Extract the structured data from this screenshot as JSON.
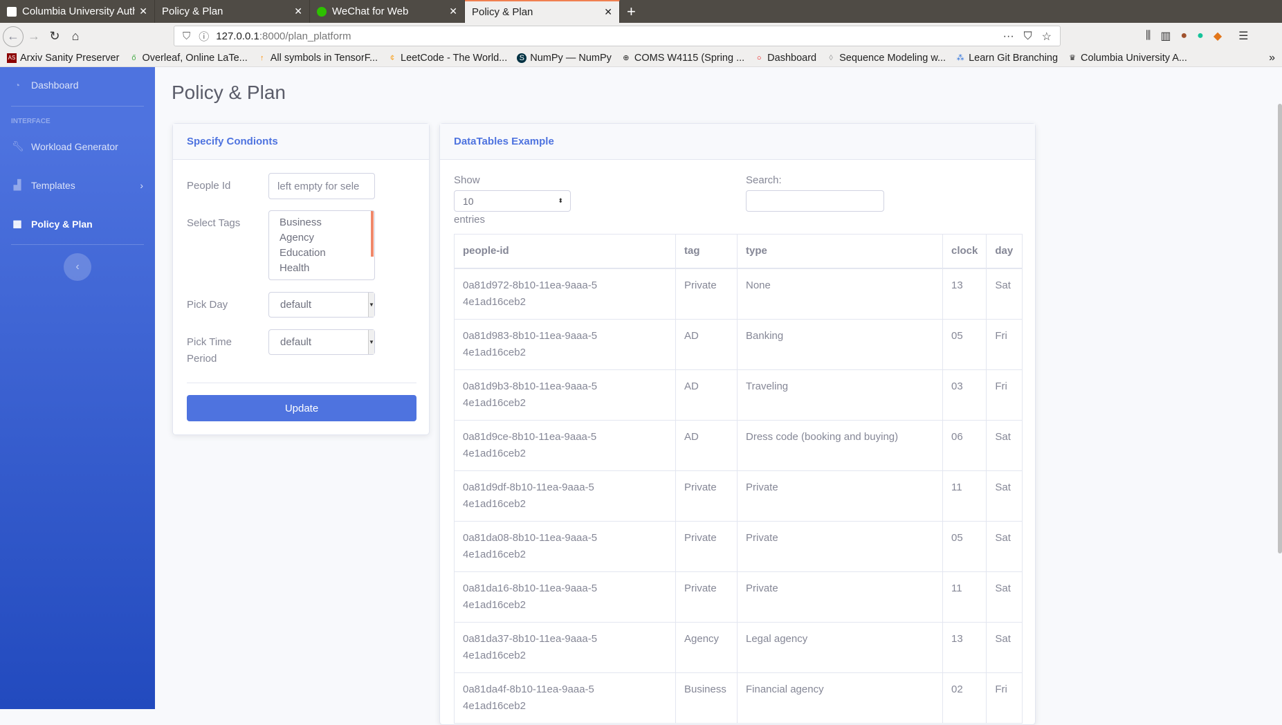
{
  "browser": {
    "tabs": [
      {
        "label": "Columbia University Auth",
        "active": false
      },
      {
        "label": "Policy & Plan",
        "active": false
      },
      {
        "label": "WeChat for Web",
        "active": false
      },
      {
        "label": "Policy & Plan",
        "active": true
      }
    ],
    "url_host": "127.0.0.1",
    "url_rest": ":8000/plan_platform",
    "bookmarks": [
      {
        "label": "Arxiv Sanity Preserver",
        "icon": "AS"
      },
      {
        "label": "Overleaf, Online LaTe...",
        "icon": "ő"
      },
      {
        "label": "All symbols in TensorF...",
        "icon": "↑"
      },
      {
        "label": "LeetCode - The World...",
        "icon": "¢"
      },
      {
        "label": "NumPy — NumPy",
        "icon": "S"
      },
      {
        "label": "COMS W4115 (Spring ...",
        "icon": "⊕"
      },
      {
        "label": "Dashboard",
        "icon": "○"
      },
      {
        "label": "Sequence Modeling w...",
        "icon": "◊"
      },
      {
        "label": "Learn Git Branching",
        "icon": "⁂"
      },
      {
        "label": "Columbia University A...",
        "icon": "♛"
      }
    ]
  },
  "sidebar": {
    "dashboard": "Dashboard",
    "section": "INTERFACE",
    "items": [
      {
        "label": "Workload Generator"
      },
      {
        "label": "Templates"
      },
      {
        "label": "Policy & Plan",
        "active": true
      }
    ]
  },
  "page": {
    "title": "Policy & Plan"
  },
  "form": {
    "header": "Specify Condionts",
    "people_id_label": "People Id",
    "people_id_placeholder": "left empty for sele",
    "tags_label": "Select Tags",
    "tags": [
      "Business",
      "Agency",
      "Education",
      "Health"
    ],
    "day_label": "Pick Day",
    "day_value": "default",
    "time_label": "Pick Time Period",
    "time_value": "default",
    "update": "Update"
  },
  "datatable": {
    "header": "DataTables Example",
    "show": "Show",
    "length": "10",
    "entries": "entries",
    "search": "Search:",
    "search_value": "",
    "columns": [
      "people-id",
      "tag",
      "type",
      "clock",
      "day"
    ],
    "rows": [
      [
        "0a81d972-8b10-11ea-9aaa-54e1ad16ceb2",
        "Private",
        "None",
        "13",
        "Sat"
      ],
      [
        "0a81d983-8b10-11ea-9aaa-54e1ad16ceb2",
        "AD",
        "Banking",
        "05",
        "Fri"
      ],
      [
        "0a81d9b3-8b10-11ea-9aaa-54e1ad16ceb2",
        "AD",
        "Traveling",
        "03",
        "Fri"
      ],
      [
        "0a81d9ce-8b10-11ea-9aaa-54e1ad16ceb2",
        "AD",
        "Dress code (booking and buying)",
        "06",
        "Sat"
      ],
      [
        "0a81d9df-8b10-11ea-9aaa-54e1ad16ceb2",
        "Private",
        "Private",
        "11",
        "Sat"
      ],
      [
        "0a81da08-8b10-11ea-9aaa-54e1ad16ceb2",
        "Private",
        "Private",
        "05",
        "Sat"
      ],
      [
        "0a81da16-8b10-11ea-9aaa-54e1ad16ceb2",
        "Private",
        "Private",
        "11",
        "Sat"
      ],
      [
        "0a81da37-8b10-11ea-9aaa-54e1ad16ceb2",
        "Agency",
        "Legal agency",
        "13",
        "Sat"
      ],
      [
        "0a81da4f-8b10-11ea-9aaa-54e1ad16ceb2",
        "Business",
        "Financial agency",
        "02",
        "Fri"
      ]
    ]
  },
  "colors": {
    "primary": "#4e73df",
    "sidebar_end": "#224abe",
    "text": "#858796"
  }
}
